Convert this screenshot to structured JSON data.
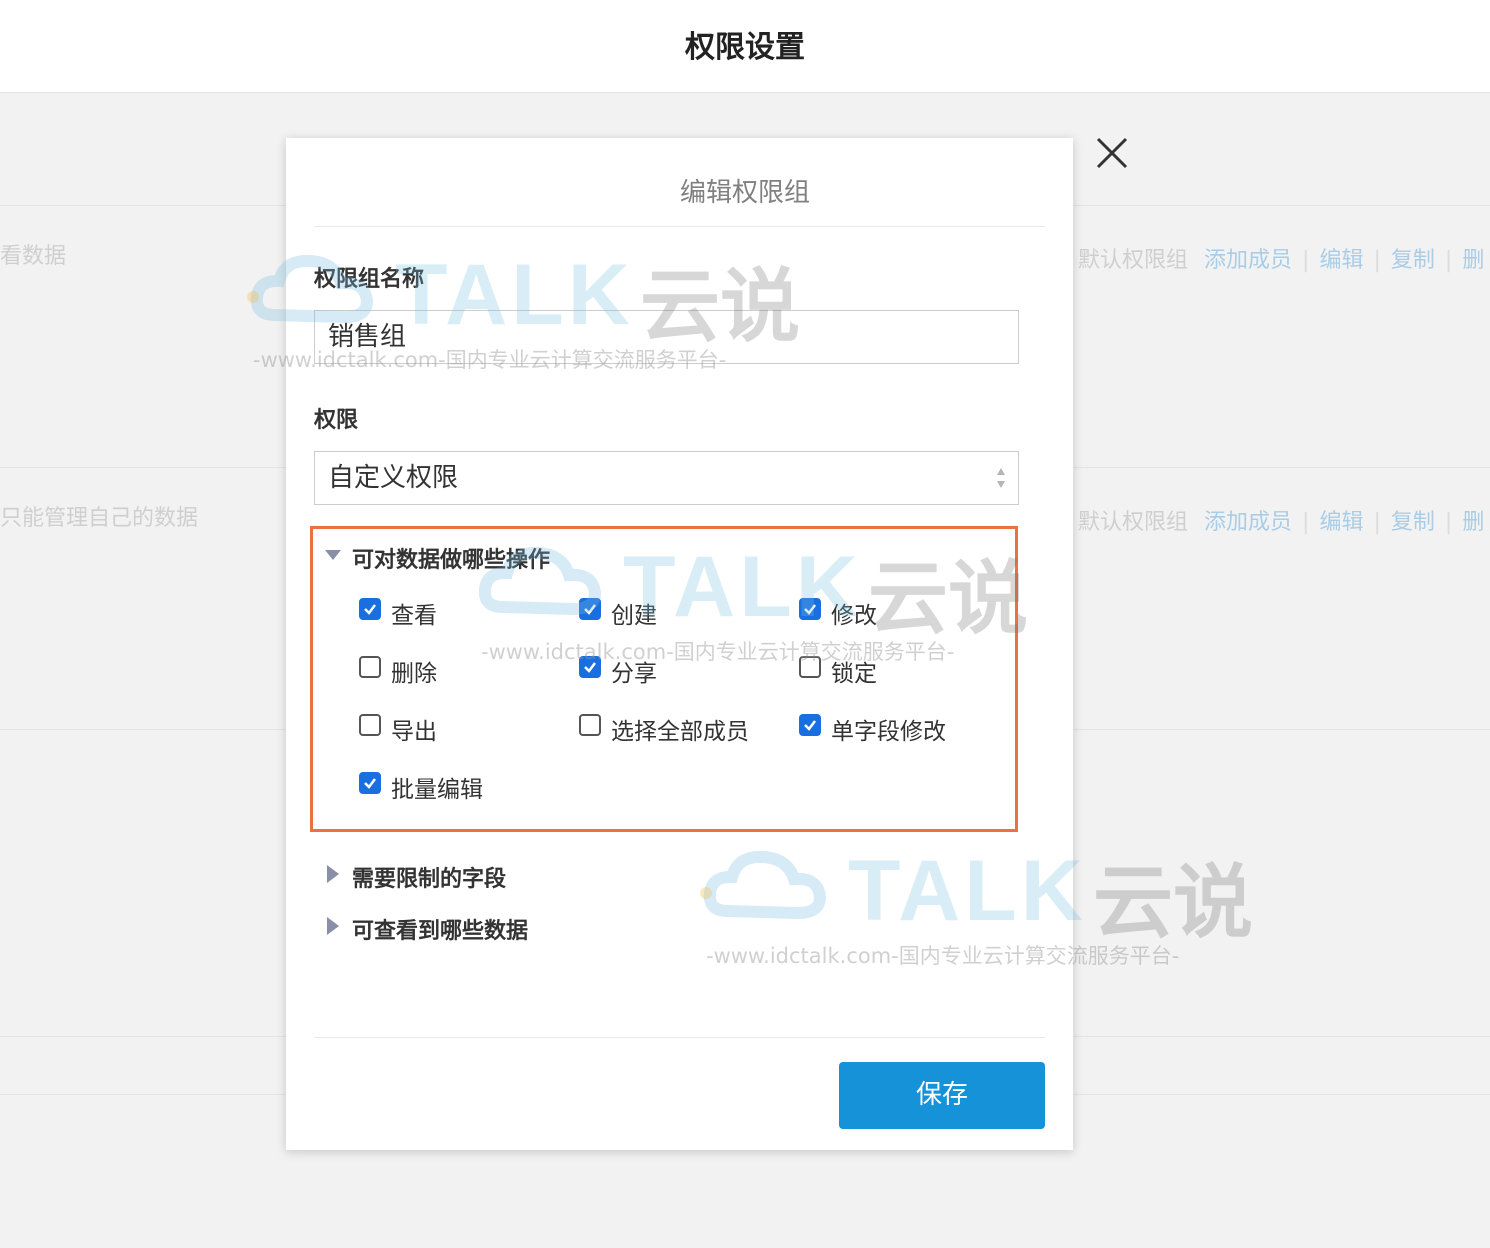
{
  "header": {
    "title": "权限设置"
  },
  "background_rows": [
    {
      "desc": "看数据",
      "actions": {
        "default": "默认权限组",
        "add_member": "添加成员",
        "edit": "编辑",
        "copy": "复制",
        "delete": "删"
      }
    },
    {
      "desc": "只能管理自己的数据",
      "actions": {
        "default": "默认权限组",
        "add_member": "添加成员",
        "edit": "编辑",
        "copy": "复制",
        "delete": "删"
      }
    }
  ],
  "modal": {
    "title": "编辑权限组",
    "name_label": "权限组名称",
    "name_value": "销售组",
    "perm_label": "权限",
    "perm_value": "自定义权限",
    "ops_section": {
      "title": "可对数据做哪些操作",
      "options": [
        {
          "label": "查看",
          "checked": true
        },
        {
          "label": "创建",
          "checked": true
        },
        {
          "label": "修改",
          "checked": true
        },
        {
          "label": "删除",
          "checked": false
        },
        {
          "label": "分享",
          "checked": true
        },
        {
          "label": "锁定",
          "checked": false
        },
        {
          "label": "导出",
          "checked": false
        },
        {
          "label": "选择全部成员",
          "checked": false
        },
        {
          "label": "单字段修改",
          "checked": true
        },
        {
          "label": "批量编辑",
          "checked": true
        }
      ]
    },
    "restricted_fields_section": {
      "title": "需要限制的字段"
    },
    "visible_data_section": {
      "title": "可查看到哪些数据"
    },
    "save_label": "保存"
  },
  "watermark": {
    "brand": "TALK",
    "brand_cn": "云说",
    "sub": "-www.idctalk.com-国内专业云计算交流服务平台-"
  },
  "colors": {
    "accent": "#1592d8",
    "highlight_border": "#e8733f",
    "checkbox": "#1a6fe0"
  }
}
